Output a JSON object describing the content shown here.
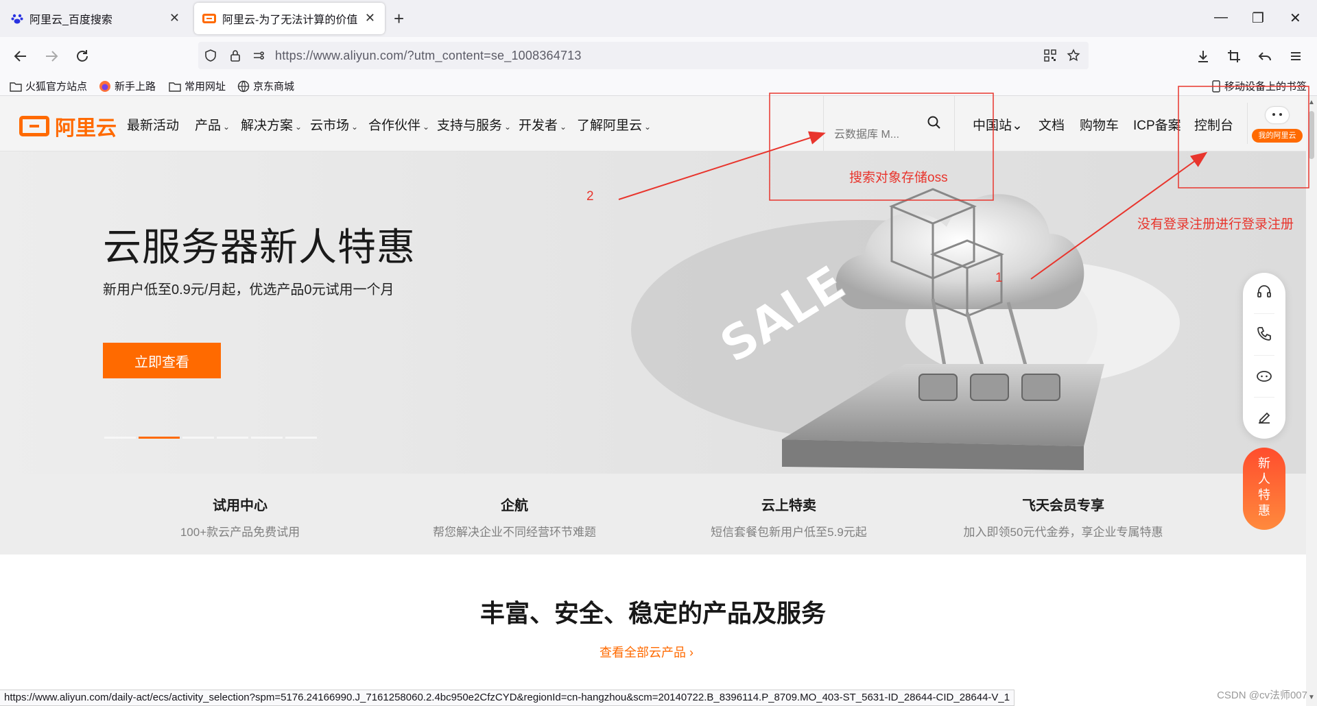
{
  "browser": {
    "tabs": [
      {
        "title": "阿里云_百度搜索",
        "active": false
      },
      {
        "title": "阿里云-为了无法计算的价值",
        "active": true
      }
    ],
    "url": "https://www.aliyun.com/?utm_content=se_1008364713",
    "bookmarks": [
      "火狐官方站点",
      "新手上路",
      "常用网址",
      "京东商城"
    ],
    "mobile_bookmarks": "移动设备上的书签"
  },
  "header": {
    "logo_text": "阿里云",
    "menu": [
      "最新活动",
      "产品",
      "解决方案",
      "云市场",
      "合作伙伴",
      "支持与服务",
      "开发者",
      "了解阿里云"
    ],
    "search_placeholder": "云数据库 M...",
    "right": [
      "中国站",
      "文档",
      "购物车",
      "ICP备案",
      "控制台"
    ],
    "user_badge": "我的阿里云"
  },
  "hero": {
    "title": "云服务器新人特惠",
    "subtitle": "新用户低至0.9元/月起，优选产品0元试用一个月",
    "cta": "立即查看",
    "art_text": "SALE",
    "slide_count": 6,
    "active_slide": 1
  },
  "features": [
    {
      "title": "试用中心",
      "desc": "100+款云产品免费试用"
    },
    {
      "title": "企航",
      "desc": "帮您解决企业不同经营环节难题"
    },
    {
      "title": "云上特卖",
      "desc": "短信套餐包新用户低至5.9元起"
    },
    {
      "title": "飞天会员专享",
      "desc": "加入即领50元代金券，享企业专属特惠"
    }
  ],
  "products": {
    "title": "丰富、安全、稳定的产品及服务",
    "link": "查看全部云产品"
  },
  "sidebar": {
    "icons": [
      "headset-icon",
      "phone-icon",
      "robot-icon",
      "edit-icon"
    ],
    "promo": [
      "新",
      "人",
      "特",
      "惠"
    ]
  },
  "status_url": "https://www.aliyun.com/daily-act/ecs/activity_selection?spm=5176.24166990.J_7161258060.2.4bc950e2CfzCYD&regionId=cn-hangzhou&scm=20140722.B_8396114.P_8709.MO_403-ST_5631-ID_28644-CID_28644-V_1",
  "watermark": "CSDN @cv法师007",
  "annotations": {
    "search_note": "搜索对象存储oss",
    "login_note": "没有登录注册进行登录注册",
    "label_1": "1",
    "label_2": "2",
    "color": "#e8352d"
  },
  "colors": {
    "brand": "#ff6a00"
  }
}
